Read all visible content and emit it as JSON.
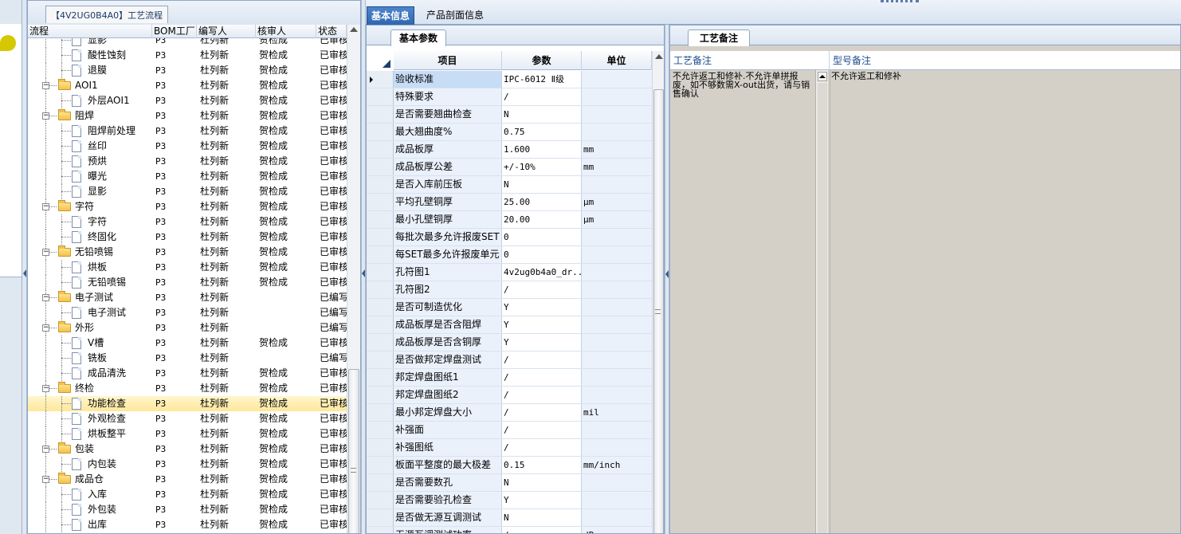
{
  "tree_panel": {
    "title": "【4V2UG0B4A0】工艺流程",
    "headers": [
      "流程",
      "BOM工厂",
      "编写人",
      "核审人",
      "状态"
    ],
    "rows": [
      {
        "name": "显影",
        "level": 2,
        "folder": false,
        "bom": "P3",
        "writer": "杜列新",
        "checker": "贺检成",
        "status": "已审核"
      },
      {
        "name": "酸性蚀刻",
        "level": 2,
        "folder": false,
        "bom": "P3",
        "writer": "杜列新",
        "checker": "贺检成",
        "status": "已审核"
      },
      {
        "name": "退膜",
        "level": 2,
        "folder": false,
        "bom": "P3",
        "writer": "杜列新",
        "checker": "贺检成",
        "status": "已审核"
      },
      {
        "name": "AOI1",
        "level": 1,
        "folder": true,
        "bom": "P3",
        "writer": "杜列新",
        "checker": "贺检成",
        "status": "已审核"
      },
      {
        "name": "外层AOI1",
        "level": 2,
        "folder": false,
        "bom": "P3",
        "writer": "杜列新",
        "checker": "贺检成",
        "status": "已审核"
      },
      {
        "name": "阻焊",
        "level": 1,
        "folder": true,
        "bom": "P3",
        "writer": "杜列新",
        "checker": "贺检成",
        "status": "已审核"
      },
      {
        "name": "阻焊前处理",
        "level": 2,
        "folder": false,
        "bom": "P3",
        "writer": "杜列新",
        "checker": "贺检成",
        "status": "已审核"
      },
      {
        "name": "丝印",
        "level": 2,
        "folder": false,
        "bom": "P3",
        "writer": "杜列新",
        "checker": "贺检成",
        "status": "已审核"
      },
      {
        "name": "预烘",
        "level": 2,
        "folder": false,
        "bom": "P3",
        "writer": "杜列新",
        "checker": "贺检成",
        "status": "已审核"
      },
      {
        "name": "曝光",
        "level": 2,
        "folder": false,
        "bom": "P3",
        "writer": "杜列新",
        "checker": "贺检成",
        "status": "已审核"
      },
      {
        "name": "显影",
        "level": 2,
        "folder": false,
        "bom": "P3",
        "writer": "杜列新",
        "checker": "贺检成",
        "status": "已审核"
      },
      {
        "name": "字符",
        "level": 1,
        "folder": true,
        "bom": "P3",
        "writer": "杜列新",
        "checker": "贺检成",
        "status": "已审核"
      },
      {
        "name": "字符",
        "level": 2,
        "folder": false,
        "bom": "P3",
        "writer": "杜列新",
        "checker": "贺检成",
        "status": "已审核"
      },
      {
        "name": "终固化",
        "level": 2,
        "folder": false,
        "bom": "P3",
        "writer": "杜列新",
        "checker": "贺检成",
        "status": "已审核"
      },
      {
        "name": "无铅喷锡",
        "level": 1,
        "folder": true,
        "bom": "P3",
        "writer": "杜列新",
        "checker": "贺检成",
        "status": "已审核"
      },
      {
        "name": "烘板",
        "level": 2,
        "folder": false,
        "bom": "P3",
        "writer": "杜列新",
        "checker": "贺检成",
        "status": "已审核"
      },
      {
        "name": "无铅喷锡",
        "level": 2,
        "folder": false,
        "bom": "P3",
        "writer": "杜列新",
        "checker": "贺检成",
        "status": "已审核"
      },
      {
        "name": "电子测试",
        "level": 1,
        "folder": true,
        "bom": "P3",
        "writer": "杜列新",
        "checker": "",
        "status": "已编写"
      },
      {
        "name": "电子测试",
        "level": 2,
        "folder": false,
        "bom": "P3",
        "writer": "杜列新",
        "checker": "",
        "status": "已编写"
      },
      {
        "name": "外形",
        "level": 1,
        "folder": true,
        "bom": "P3",
        "writer": "杜列新",
        "checker": "",
        "status": "已编写"
      },
      {
        "name": "V槽",
        "level": 2,
        "folder": false,
        "bom": "P3",
        "writer": "杜列新",
        "checker": "贺检成",
        "status": "已审核"
      },
      {
        "name": "铣板",
        "level": 2,
        "folder": false,
        "bom": "P3",
        "writer": "杜列新",
        "checker": "",
        "status": "已编写"
      },
      {
        "name": "成品清洗",
        "level": 2,
        "folder": false,
        "bom": "P3",
        "writer": "杜列新",
        "checker": "贺检成",
        "status": "已审核"
      },
      {
        "name": "终检",
        "level": 1,
        "folder": true,
        "bom": "P3",
        "writer": "杜列新",
        "checker": "贺检成",
        "status": "已审核"
      },
      {
        "name": "功能检查",
        "level": 2,
        "folder": false,
        "bom": "P3",
        "writer": "杜列新",
        "checker": "贺检成",
        "status": "已审核",
        "selected": true
      },
      {
        "name": "外观检查",
        "level": 2,
        "folder": false,
        "bom": "P3",
        "writer": "杜列新",
        "checker": "贺检成",
        "status": "已审核"
      },
      {
        "name": "烘板整平",
        "level": 2,
        "folder": false,
        "bom": "P3",
        "writer": "杜列新",
        "checker": "贺检成",
        "status": "已审核"
      },
      {
        "name": "包装",
        "level": 1,
        "folder": true,
        "bom": "P3",
        "writer": "杜列新",
        "checker": "贺检成",
        "status": "已审核"
      },
      {
        "name": "内包装",
        "level": 2,
        "folder": false,
        "bom": "P3",
        "writer": "杜列新",
        "checker": "贺检成",
        "status": "已审核"
      },
      {
        "name": "成品仓",
        "level": 1,
        "folder": true,
        "bom": "P3",
        "writer": "杜列新",
        "checker": "贺检成",
        "status": "已审核"
      },
      {
        "name": "入库",
        "level": 2,
        "folder": false,
        "bom": "P3",
        "writer": "杜列新",
        "checker": "贺检成",
        "status": "已审核"
      },
      {
        "name": "外包装",
        "level": 2,
        "folder": false,
        "bom": "P3",
        "writer": "杜列新",
        "checker": "贺检成",
        "status": "已审核"
      },
      {
        "name": "出库",
        "level": 2,
        "folder": false,
        "bom": "P3",
        "writer": "杜列新",
        "checker": "贺检成",
        "status": "已审核"
      }
    ]
  },
  "top_tabs": [
    "基本信息",
    "产品剖面信息"
  ],
  "params_panel": {
    "tab": "基本参数",
    "headers": [
      "项目",
      "参数",
      "单位"
    ],
    "rows": [
      {
        "item": "验收标准",
        "value": "IPC-6012 Ⅱ级",
        "unit": "",
        "current": true
      },
      {
        "item": "特殊要求",
        "value": "/",
        "unit": ""
      },
      {
        "item": "是否需要翘曲检查",
        "value": "N",
        "unit": ""
      },
      {
        "item": "最大翘曲度%",
        "value": "0.75",
        "unit": ""
      },
      {
        "item": "成品板厚",
        "value": "1.600",
        "unit": "mm"
      },
      {
        "item": "成品板厚公差",
        "value": "+/-10%",
        "unit": "mm"
      },
      {
        "item": "是否入库前压板",
        "value": "N",
        "unit": ""
      },
      {
        "item": "平均孔壁铜厚",
        "value": "25.00",
        "unit": "μm"
      },
      {
        "item": "最小孔壁铜厚",
        "value": "20.00",
        "unit": "μm"
      },
      {
        "item": "每批次最多允许报废SET",
        "value": "0",
        "unit": ""
      },
      {
        "item": "每SET最多允许报废单元",
        "value": "0",
        "unit": ""
      },
      {
        "item": "孔符图1",
        "value": "4v2ug0b4a0_dr...",
        "unit": ""
      },
      {
        "item": "孔符图2",
        "value": "/",
        "unit": ""
      },
      {
        "item": "是否可制造优化",
        "value": "Y",
        "unit": ""
      },
      {
        "item": "成品板厚是否含阻焊",
        "value": "Y",
        "unit": ""
      },
      {
        "item": "成品板厚是否含铜厚",
        "value": "Y",
        "unit": ""
      },
      {
        "item": "是否做邦定焊盘测试",
        "value": "/",
        "unit": ""
      },
      {
        "item": "邦定焊盘图纸1",
        "value": "/",
        "unit": ""
      },
      {
        "item": "邦定焊盘图纸2",
        "value": "/",
        "unit": ""
      },
      {
        "item": "最小邦定焊盘大小",
        "value": "/",
        "unit": "mil"
      },
      {
        "item": "补强面",
        "value": "/",
        "unit": ""
      },
      {
        "item": "补强图纸",
        "value": "/",
        "unit": ""
      },
      {
        "item": "板面平整度的最大极差",
        "value": "0.15",
        "unit": "mm/inch"
      },
      {
        "item": "是否需要数孔",
        "value": "N",
        "unit": ""
      },
      {
        "item": "是否需要验孔检查",
        "value": "Y",
        "unit": ""
      },
      {
        "item": "是否做无源互调测试",
        "value": "N",
        "unit": ""
      },
      {
        "item": "无源互调测试功率",
        "value": "/",
        "unit": "dBm"
      }
    ]
  },
  "notes_panel": {
    "tab": "工艺备注",
    "col1_header": "工艺备注",
    "col2_header": "型号备注",
    "process_note": "不允许返工和修补.不允许单拼报废，如不够数需X-out出货，请与销售确认",
    "model_note": "不允许返工和修补"
  },
  "colors": {
    "selected_row": "#ffe79a",
    "tab_active": "#2f66b0",
    "header_text": "#1f4d8c"
  }
}
